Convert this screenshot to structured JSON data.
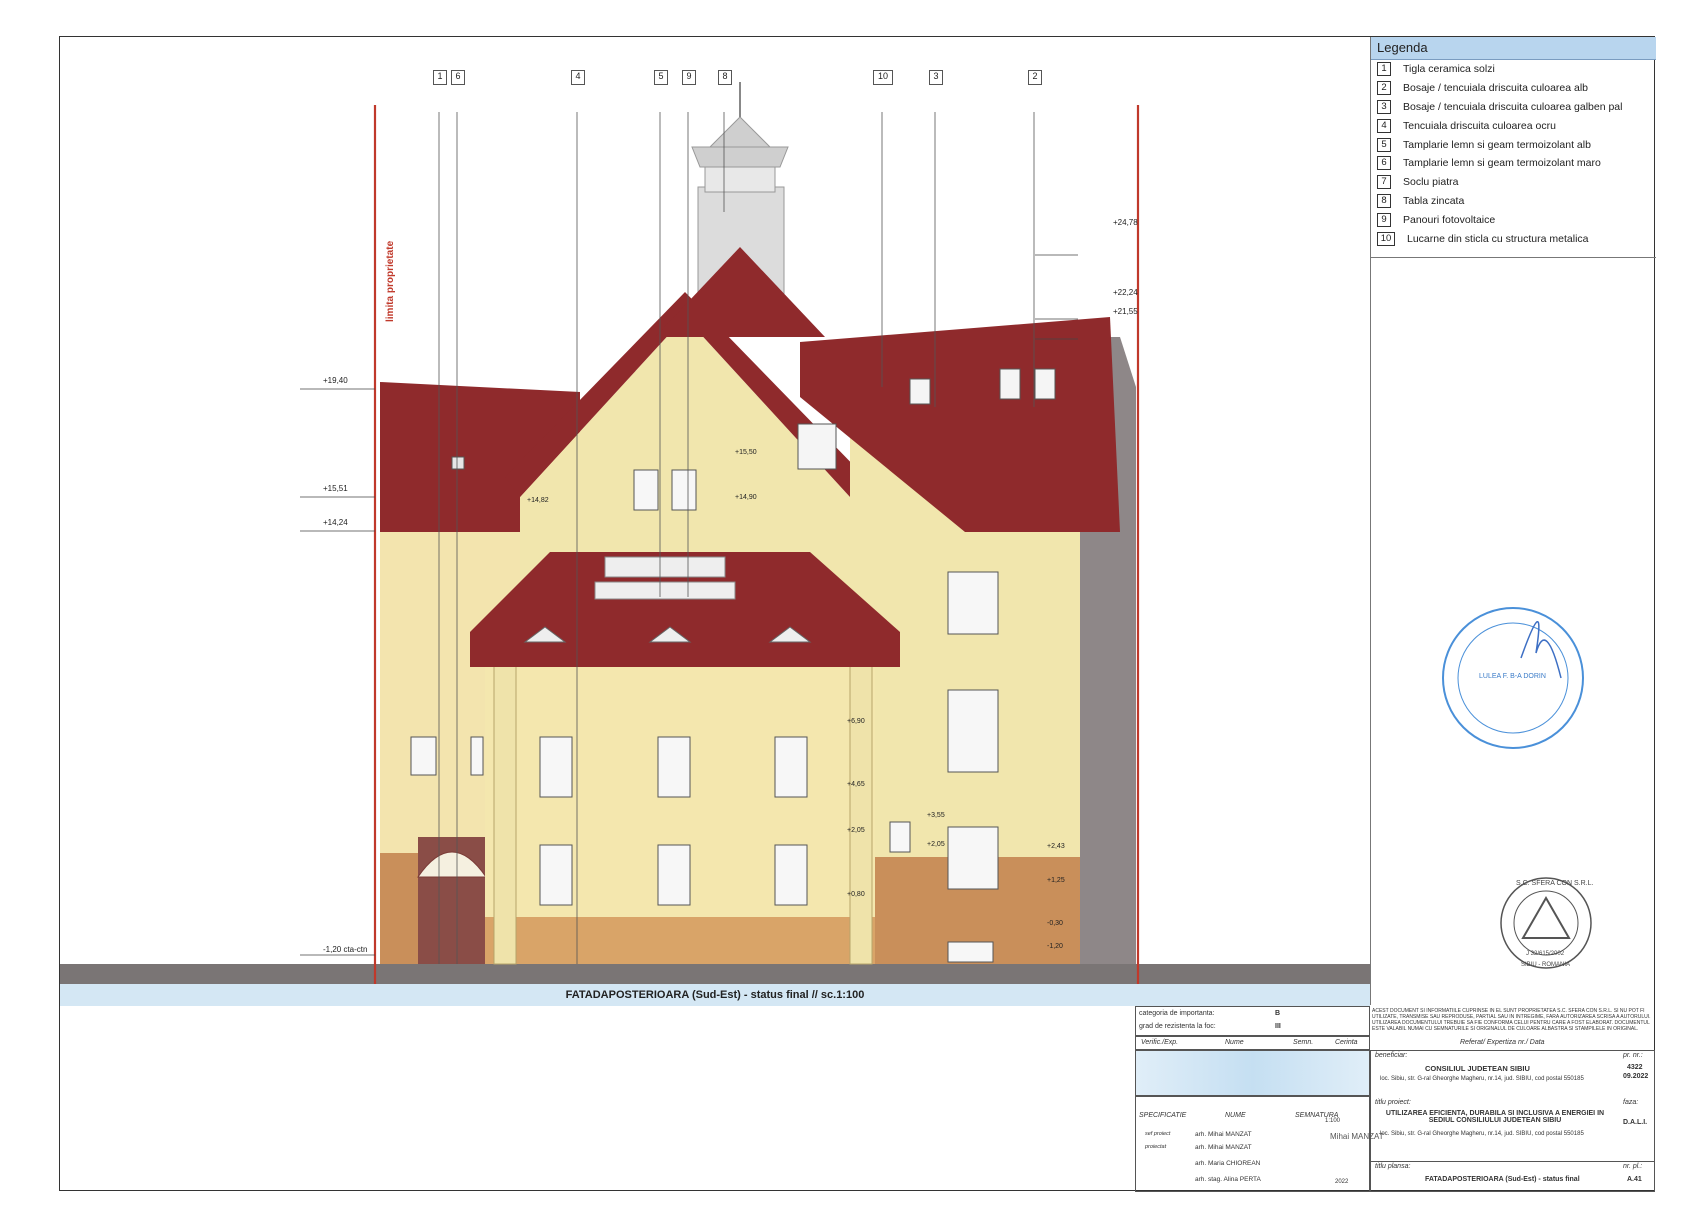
{
  "drawing": {
    "caption": "FATADAPOSTERIOARA (Sud-Est) - status final // sc.1:100",
    "property_line_label": "limita proprietate",
    "callouts": [
      "1",
      "6",
      "4",
      "5",
      "9",
      "8",
      "10",
      "3",
      "2"
    ],
    "levels_left": [
      "+19,40",
      "+15,51",
      "+14,24",
      "-1,20 cta-ctn"
    ],
    "levels_right": [
      "+24,78",
      "+22,24",
      "+21,55"
    ],
    "levels_inner": [
      "+15,50",
      "+14,90",
      "+14,82",
      "+6,90",
      "+4,65",
      "+2,05",
      "+0,80",
      "+3,55",
      "+2,05",
      "+2,43",
      "+1,25",
      "-0,30",
      "-1,20"
    ]
  },
  "legend": {
    "title": "Legenda",
    "items": [
      {
        "num": "1",
        "text": "Tigla ceramica solzi"
      },
      {
        "num": "2",
        "text": "Bosaje / tencuiala driscuita culoarea alb"
      },
      {
        "num": "3",
        "text": "Bosaje / tencuiala driscuita culoarea galben pal"
      },
      {
        "num": "4",
        "text": "Tencuiala driscuita culoarea ocru"
      },
      {
        "num": "5",
        "text": "Tamplarie lemn si geam termoizolant alb"
      },
      {
        "num": "6",
        "text": "Tamplarie lemn si geam termoizolant maro"
      },
      {
        "num": "7",
        "text": "Soclu piatra"
      },
      {
        "num": "8",
        "text": "Tabla zincata"
      },
      {
        "num": "9",
        "text": "Panouri fotovoltaice"
      },
      {
        "num": "10",
        "text": "Lucarne din sticla cu structura metalica"
      }
    ]
  },
  "stamps": {
    "architect": "LULEA F. B-A DORIN",
    "company": "S.C. SFERA CON S.R.L.",
    "company_reg": "J 32/615/2002",
    "company_city": "SIBIU - ROMANIA"
  },
  "title_block": {
    "categoria_label": "categoria de importanta:",
    "categoria_value": "B",
    "grad_label": "grad de rezistenta la foc:",
    "grad_value": "III",
    "legal_notice": "ACEST DOCUMENT SI INFORMATIILE CUPRINSE IN EL SUNT PROPRIETATEA S.C. SFERA CON S.R.L. SI NU POT FI UTILIZATE, TRANSMISE SAU REPRODUSE, PARTIAL SAU IN INTREGIME, FARA AUTORIZAREA SCRISA A AUTORULUI. UTILIZAREA DOCUMENTULUI TREBUIE SA FIE CONFORMA CELUI PENTRU CARE A FOST ELABORAT. DOCUMENTUL ESTE VALABIL NUMAI CU SEMNATURILE SI ORIGINALUL DE CULOARE ALBASTRA SI STAMPILELE IN ORIGINAL.",
    "verif_headers": [
      "Verific./Exp.",
      "Nume",
      "Semn.",
      "Cerinta"
    ],
    "referat": "Referat/ Expertiza nr./ Data",
    "beneficiar_label": "beneficiar:",
    "beneficiar": "CONSILIUL JUDETEAN SIBIU",
    "beneficiar_addr": "loc. Sibiu, str. G-ral Gheorghe Magheru, nr.14, jud. SIBIU, cod postal 550185",
    "pr_nr_label": "pr. nr.:",
    "pr_nr": "4322",
    "pr_date": "09.2022",
    "titlu_label": "titlu proiect:",
    "titlu": "UTILIZAREA EFICIENTA, DURABILA SI INCLUSIVA A ENERGIEI IN SEDIUL CONSILIULUI JUDETEAN SIBIU",
    "titlu_addr": "loc. Sibiu, str. G-ral Gheorghe Magheru, nr.14, jud. SIBIU, cod postal 550185",
    "faza_label": "faza:",
    "faza": "D.A.L.I.",
    "spec_headers": [
      "SPECIFICATIE",
      "NUME",
      "SEMNATURA"
    ],
    "people": [
      {
        "role": "sef proiect",
        "name": "arh. Mihai MANZAT"
      },
      {
        "role": "proiectat",
        "name": "arh. Mihai MANZAT"
      },
      {
        "role": "",
        "name": "arh. Maria CHIOREAN"
      },
      {
        "role": "",
        "name": "arh. stag. Alina PERTA"
      }
    ],
    "scale": "1:100",
    "year": "2022",
    "arch_stamp": "Mihai MANZAT",
    "titlu_plansa_label": "titlu plansa:",
    "titlu_plansa": "FATADAPOSTERIOARA (Sud-Est) - status final",
    "nr_pl_label": "nr. pl.:",
    "nr_pl": "A.41"
  }
}
